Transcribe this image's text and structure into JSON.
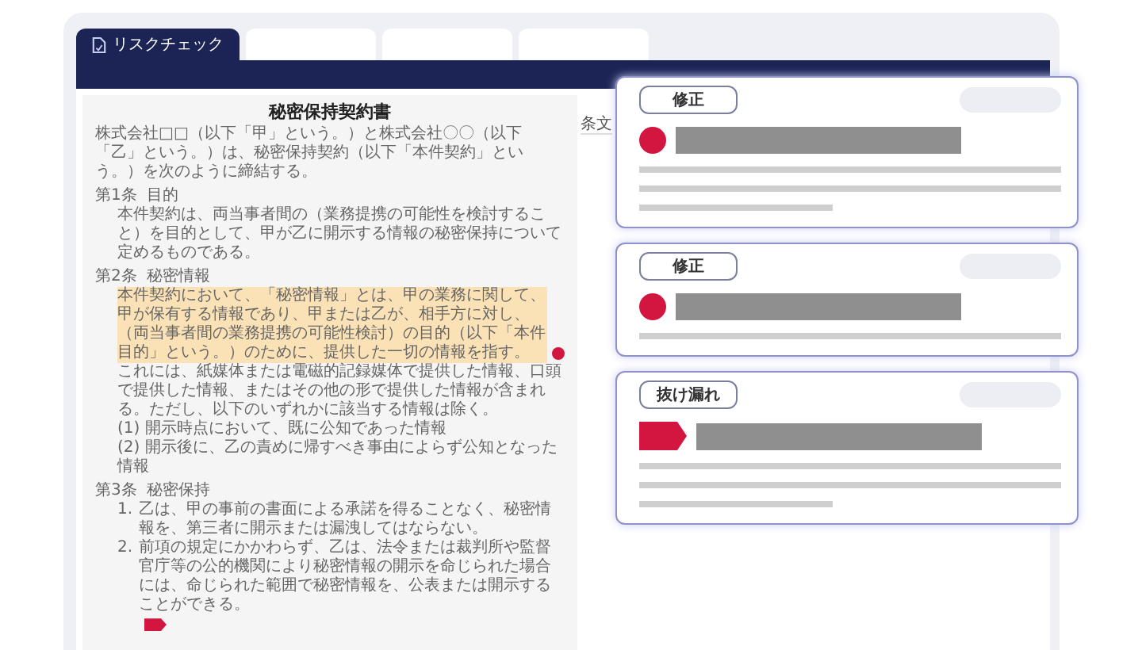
{
  "tabs": [
    {
      "label": "リスクチェック",
      "selected": true
    },
    {
      "selected": false
    },
    {
      "selected": false
    },
    {
      "selected": false
    }
  ],
  "side_label": "条文",
  "document": {
    "title": "秘密保持契約書",
    "intro": "株式会社□□（以下「甲」という。）と株式会社〇〇（以下「乙」という。）は、秘密保持契約（以下「本件契約」という。）を次のように締結する。",
    "articles": [
      {
        "number": "第1条",
        "heading": "目的",
        "paragraphs": [
          {
            "text": "本件契約は、両当事者間の（業務提携の可能性を検討すること）を目的として、甲が乙に開示する情報の秘密保持について定めるものである。",
            "highlighted": false
          }
        ]
      },
      {
        "number": "第2条",
        "heading": "秘密情報",
        "paragraphs": [
          {
            "text": "本件契約において、「秘密情報」とは、甲の業務に関して、甲が保有する情報であり、甲または乙が、相手方に対し、（両当事者間の業務提携の可能性検討）の目的（以下「本件目的」という。）のために、提供した一切の情報を指す。",
            "highlighted": true,
            "marker": {
              "kind": "dot"
            }
          },
          {
            "text": "これには、紙媒体または電磁的記録媒体で提供した情報、口頭で提供した情報、またはその他の形で提供した情報が含まれる。ただし、以下のいずれかに該当する情報は除く。",
            "highlighted": false
          },
          {
            "text": "(1) 開示時点において、既に公知であった情報",
            "highlighted": false
          },
          {
            "text": "(2) 開示後に、乙の責めに帰すべき事由によらず公知となった情報",
            "highlighted": false
          }
        ]
      },
      {
        "number": "第3条",
        "heading": "秘密保持",
        "paragraphs": [
          {
            "item": "1.",
            "text": "乙は、甲の事前の書面による承諾を得ることなく、秘密情報を、第三者に開示または漏洩してはならない。",
            "highlighted": false
          },
          {
            "item": "2.",
            "text": "前項の規定にかかわらず、乙は、法令または裁判所や監督官庁等の公的機関により秘密情報の開示を命じられた場合には、命じられた範囲で秘密情報を、公表または開示することができる。",
            "highlighted": false,
            "marker": {
              "kind": "flag"
            }
          }
        ]
      }
    ]
  },
  "cards": [
    {
      "tag": "修正",
      "kind": "dot",
      "skeleton_lines": [
        {
          "kind": "full"
        },
        {
          "kind": "full"
        },
        {
          "kind": "short"
        }
      ]
    },
    {
      "tag": "修正",
      "kind": "dot",
      "skeleton_lines": [
        {
          "kind": "full"
        }
      ]
    },
    {
      "tag": "抜け漏れ",
      "kind": "flag",
      "skeleton_lines": [
        {
          "kind": "full"
        },
        {
          "kind": "full"
        },
        {
          "kind": "short"
        }
      ]
    }
  ]
}
